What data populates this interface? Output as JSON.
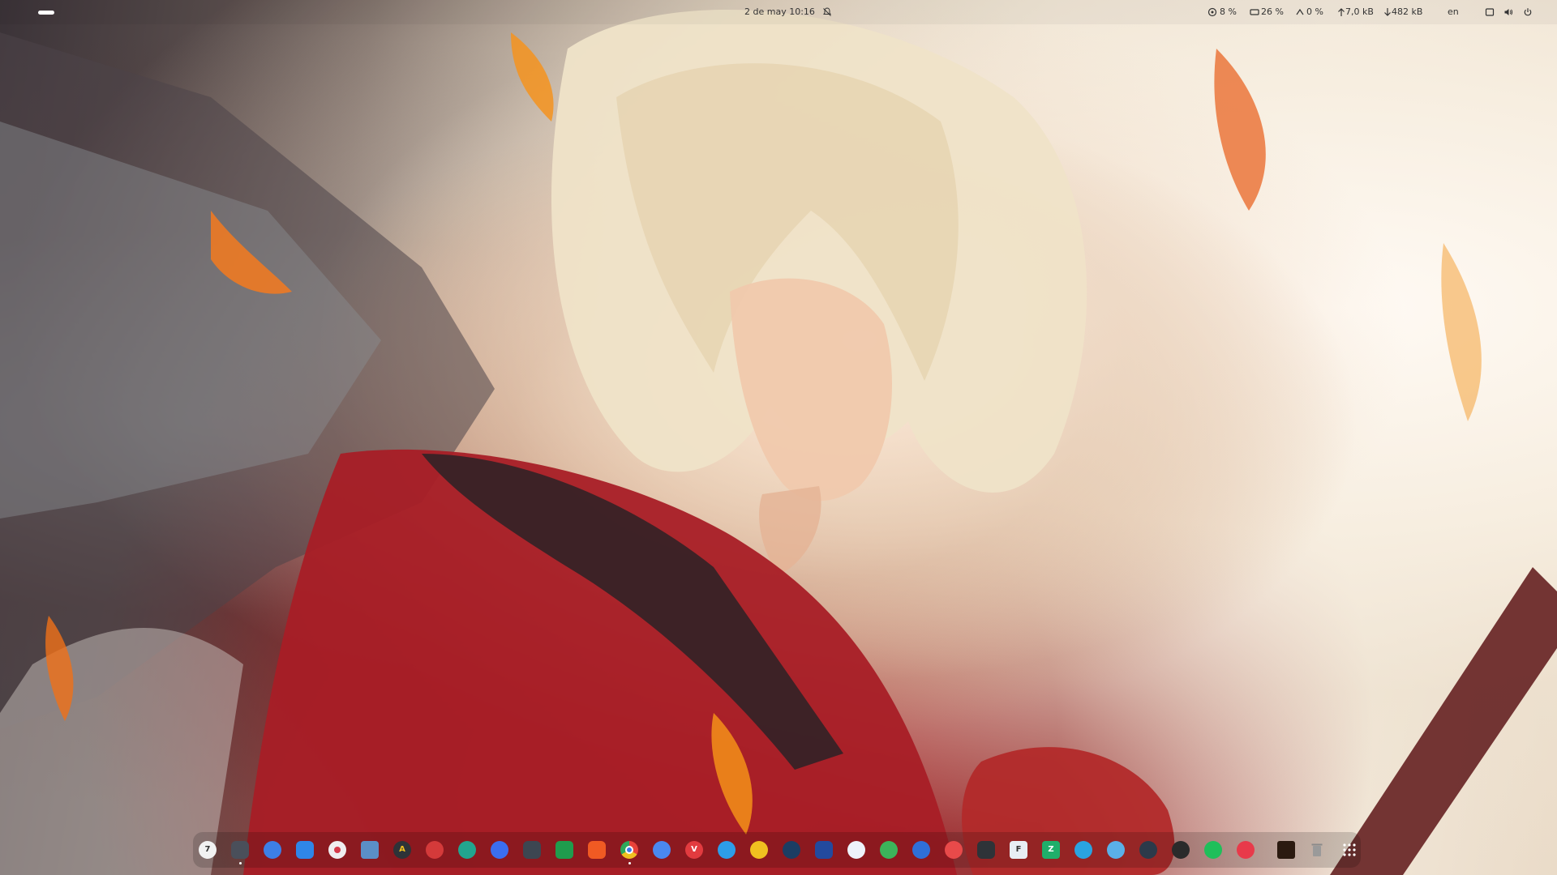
{
  "topbar": {
    "clock": "2 de may  10:16",
    "cpu": "8 %",
    "memory": "26 %",
    "swap": "0 %",
    "net_up": "7,0 kB",
    "net_down": "482 kB",
    "keyboard_layout": "en"
  },
  "dock": {
    "calendar_day": "7",
    "app_icons": [
      {
        "name": "calendar-icon",
        "color": "#f2f2f2"
      },
      {
        "name": "files-icon",
        "color": "#4a4f5a",
        "running": true
      },
      {
        "name": "mail-icon",
        "color": "#3d7fe6"
      },
      {
        "name": "store-icon",
        "color": "#2f86e8"
      },
      {
        "name": "cheese-icon",
        "color": "#f0eef0"
      },
      {
        "name": "printer-icon",
        "color": "#5b8fc7"
      },
      {
        "name": "text-editor-icon",
        "color": "#2e3338"
      },
      {
        "name": "record-icon",
        "color": "#d43a3a"
      },
      {
        "name": "monitor-icon",
        "color": "#22a58f"
      },
      {
        "name": "messages-icon",
        "color": "#3b6ef0"
      },
      {
        "name": "extensions-icon",
        "color": "#3d4651"
      },
      {
        "name": "hexagon-app-icon",
        "color": "#1f9c4d"
      },
      {
        "name": "brave-icon",
        "color": "#f05a23"
      },
      {
        "name": "chrome-icon",
        "color": "#e8b42b",
        "running": true
      },
      {
        "name": "chromium-icon",
        "color": "#4a88f0"
      },
      {
        "name": "vivaldi-icon",
        "color": "#e23b3f"
      },
      {
        "name": "safari-icon",
        "color": "#2d9de8"
      },
      {
        "name": "app-yellow-icon",
        "color": "#f0c020"
      },
      {
        "name": "steam-icon",
        "color": "#1c3d63"
      },
      {
        "name": "bitwarden-icon",
        "color": "#234a9e"
      },
      {
        "name": "clipboard-icon",
        "color": "#eef3fb"
      },
      {
        "name": "app-green-icon",
        "color": "#3cb45a"
      },
      {
        "name": "proton-icon",
        "color": "#2f6fd8"
      },
      {
        "name": "app-red-icon",
        "color": "#e84a4a"
      },
      {
        "name": "sticky-icon",
        "color": "#2e3338"
      },
      {
        "name": "font-viewer-icon",
        "color": "#e8eef5"
      },
      {
        "name": "zotero-icon",
        "color": "#1faf6a"
      },
      {
        "name": "telegram-icon",
        "color": "#2aa3e0"
      },
      {
        "name": "sphere-icon",
        "color": "#5ab0e8"
      },
      {
        "name": "toggle-icon",
        "color": "#2c3a4a"
      },
      {
        "name": "terminal-icon",
        "color": "#2b2b2b"
      },
      {
        "name": "whatsapp-icon",
        "color": "#1fbf5a"
      },
      {
        "name": "headphones-icon",
        "color": "#e83a4a"
      },
      {
        "name": "tile-app-icon",
        "color": "#2b1a10"
      },
      {
        "name": "trash-icon",
        "color": "#9a9a9a"
      },
      {
        "name": "app-grid-icon",
        "color": "#ffffff"
      }
    ]
  }
}
